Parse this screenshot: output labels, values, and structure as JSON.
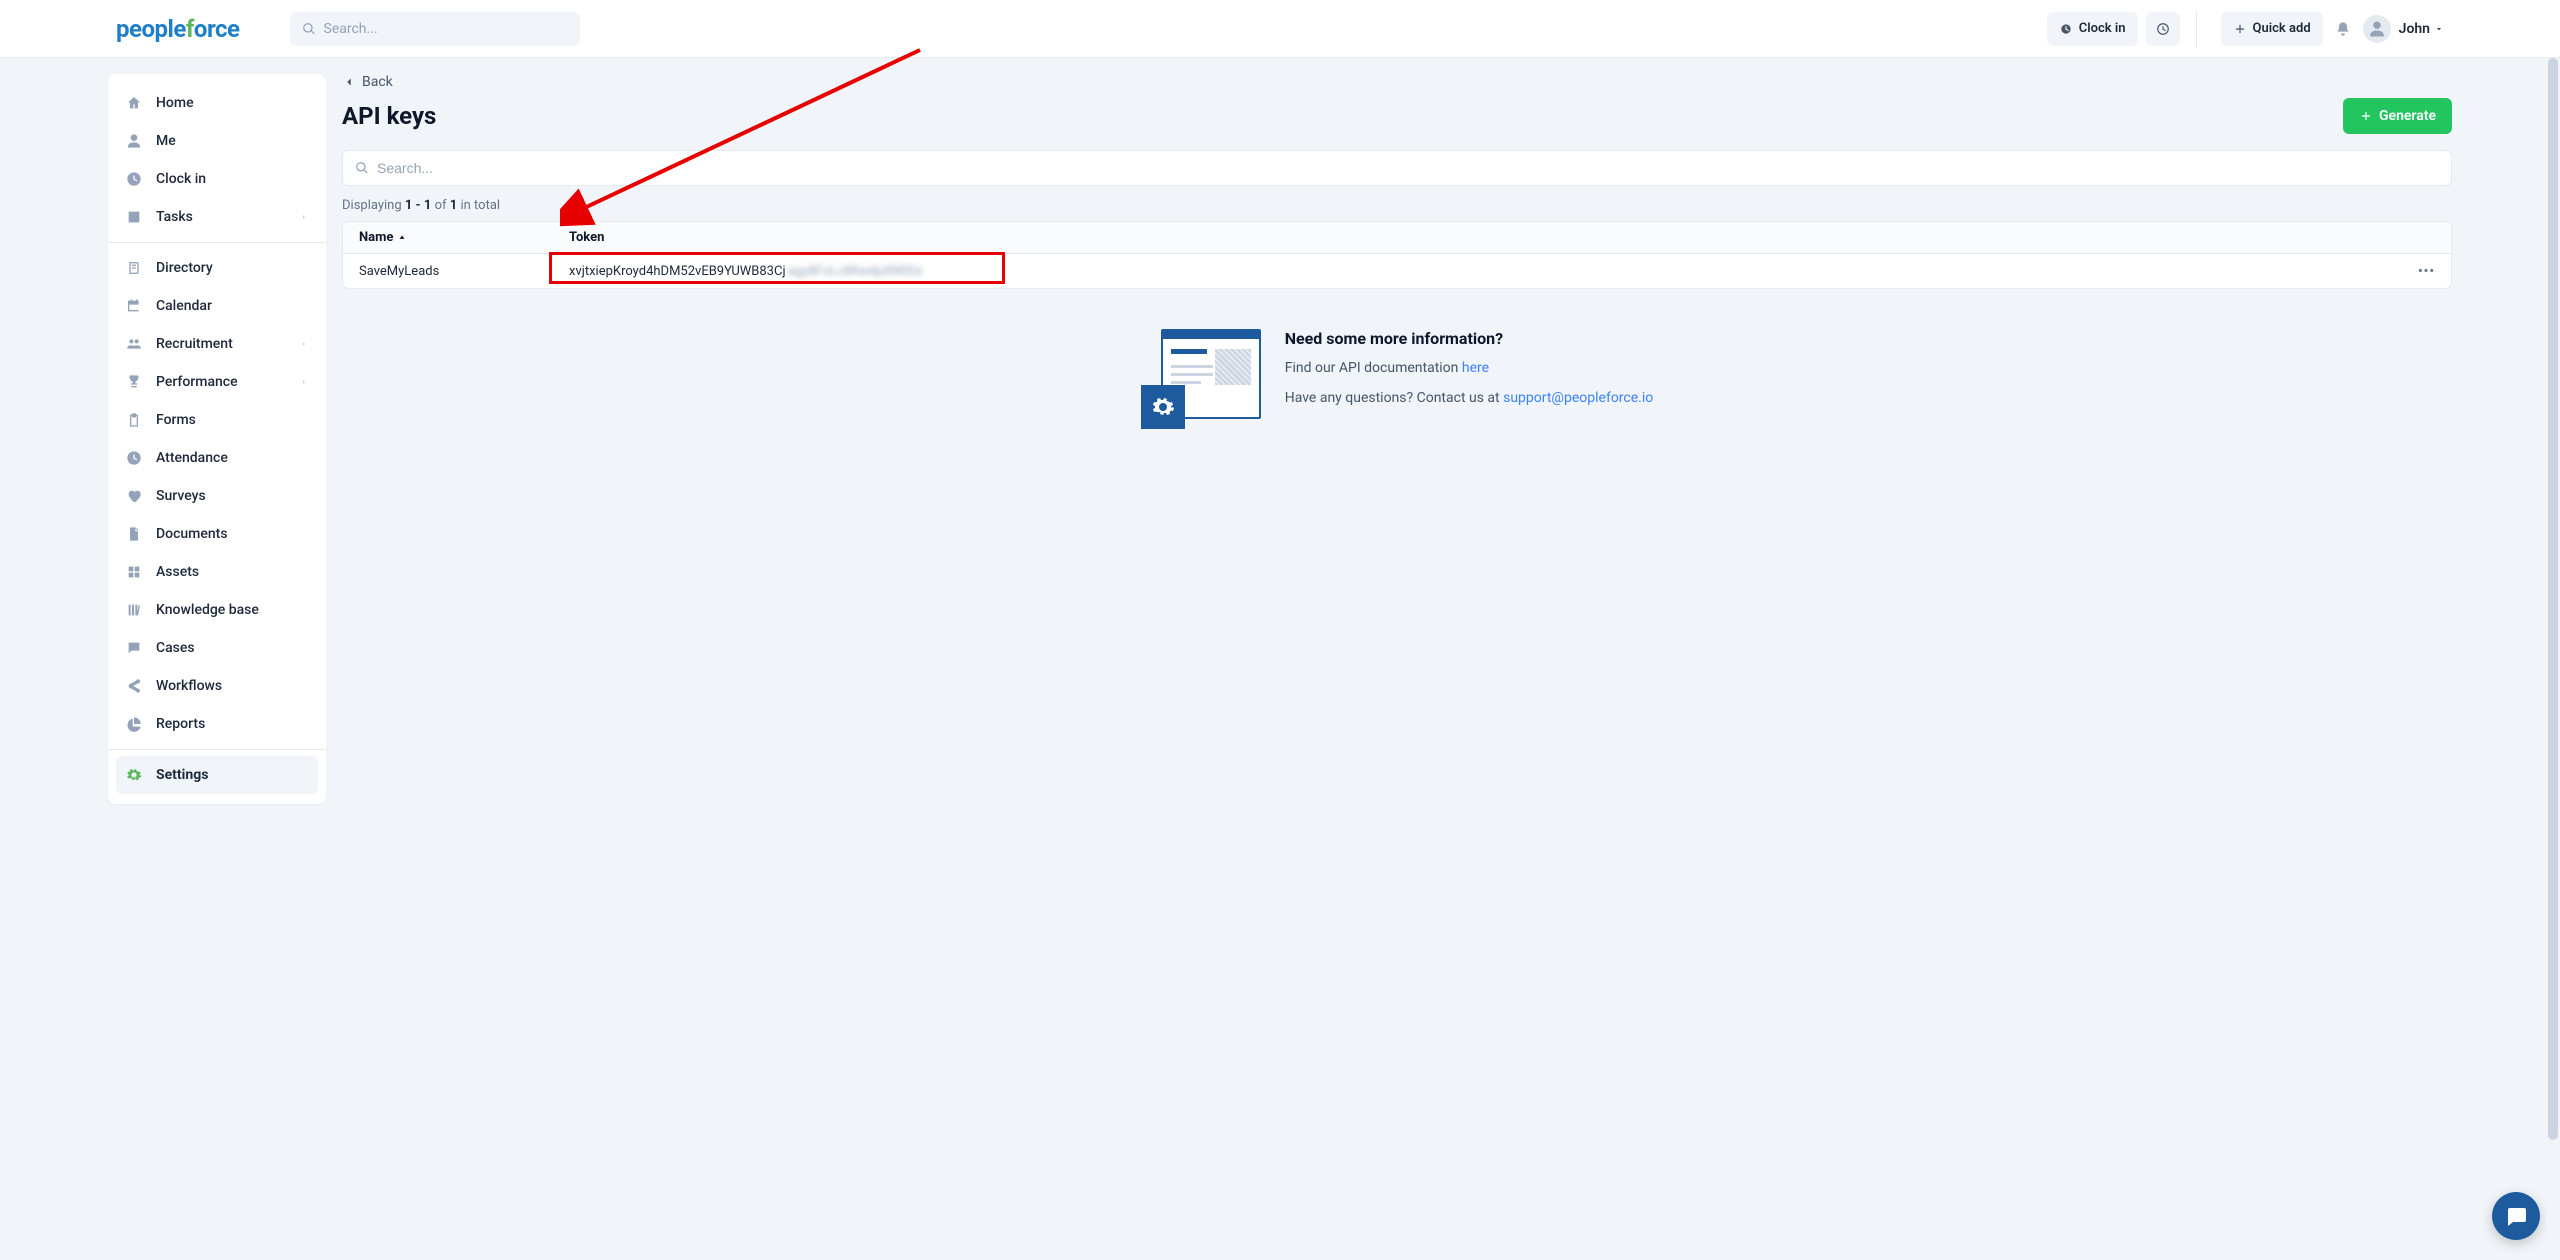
{
  "header": {
    "logo_parts": {
      "a": "people",
      "b": "f",
      "c": "orce"
    },
    "search_placeholder": "Search...",
    "clockin_label": "Clock in",
    "quickadd_label": "Quick add",
    "user_name": "John"
  },
  "sidebar": {
    "items": [
      {
        "label": "Home",
        "icon": "home",
        "chevron": false
      },
      {
        "label": "Me",
        "icon": "user",
        "chevron": false
      },
      {
        "label": "Clock in",
        "icon": "clock",
        "chevron": false
      },
      {
        "label": "Tasks",
        "icon": "check",
        "chevron": true
      }
    ],
    "items2": [
      {
        "label": "Directory",
        "icon": "addressbook",
        "chevron": false
      },
      {
        "label": "Calendar",
        "icon": "calendar",
        "chevron": false
      },
      {
        "label": "Recruitment",
        "icon": "users",
        "chevron": true
      },
      {
        "label": "Performance",
        "icon": "trophy",
        "chevron": true
      },
      {
        "label": "Forms",
        "icon": "clipboard",
        "chevron": false
      },
      {
        "label": "Attendance",
        "icon": "clock",
        "chevron": false
      },
      {
        "label": "Surveys",
        "icon": "heart",
        "chevron": false
      },
      {
        "label": "Documents",
        "icon": "file",
        "chevron": false
      },
      {
        "label": "Assets",
        "icon": "boxes",
        "chevron": false
      },
      {
        "label": "Knowledge base",
        "icon": "library",
        "chevron": false
      },
      {
        "label": "Cases",
        "icon": "message",
        "chevron": false
      },
      {
        "label": "Workflows",
        "icon": "share",
        "chevron": false
      },
      {
        "label": "Reports",
        "icon": "piechart",
        "chevron": false
      }
    ],
    "items3": [
      {
        "label": "Settings",
        "icon": "gear",
        "chevron": false,
        "active": true
      }
    ]
  },
  "main": {
    "back_label": "Back",
    "page_title": "API keys",
    "generate_label": "Generate",
    "search_placeholder": "Search...",
    "displaying": {
      "prefix": "Displaying ",
      "range": "1 - 1",
      "mid": " of ",
      "total": "1",
      "suffix": " in total"
    },
    "columns": {
      "name": "Name",
      "token": "Token"
    },
    "rows": [
      {
        "name": "SaveMyLeads",
        "token_visible": "xvjtxiepKroyd4hDM52vEB9YUWB83Cj",
        "token_hidden": "agy8FoLc8KwdpXN0Dz"
      }
    ],
    "info": {
      "heading": "Need some more information?",
      "line1_prefix": "Find our API documentation ",
      "line1_link": "here",
      "line2_prefix": "Have any questions? Contact us at ",
      "line2_link": "support@peopleforce.io"
    }
  }
}
